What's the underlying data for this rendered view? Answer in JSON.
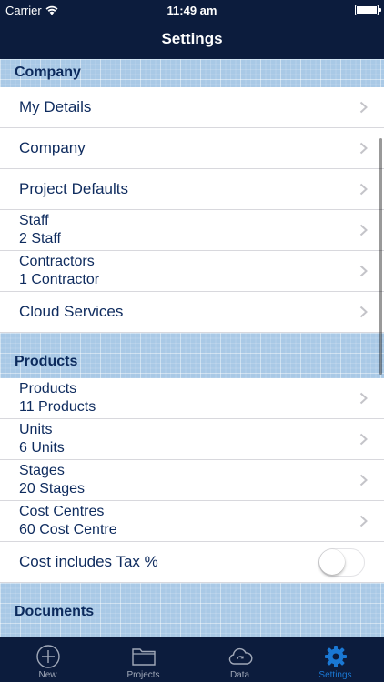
{
  "status_bar": {
    "carrier": "Carrier",
    "time": "11:49 am"
  },
  "nav": {
    "title": "Settings"
  },
  "sections": {
    "company": {
      "header": "Company"
    },
    "products": {
      "header": "Products"
    },
    "documents": {
      "header": "Documents"
    }
  },
  "company_rows": {
    "my_details": {
      "title": "My Details"
    },
    "company": {
      "title": "Company"
    },
    "project_defaults": {
      "title": "Project Defaults"
    },
    "staff": {
      "title": "Staff",
      "subtitle": "2 Staff"
    },
    "contractors": {
      "title": "Contractors",
      "subtitle": "1 Contractor"
    },
    "cloud_services": {
      "title": "Cloud Services"
    }
  },
  "product_rows": {
    "products": {
      "title": "Products",
      "subtitle": "11 Products"
    },
    "units": {
      "title": "Units",
      "subtitle": "6 Units"
    },
    "stages": {
      "title": "Stages",
      "subtitle": "20 Stages"
    },
    "cost_centres": {
      "title": "Cost Centres",
      "subtitle": "60 Cost Centre"
    },
    "cost_tax": {
      "title": "Cost includes Tax %",
      "toggle_on": false
    }
  },
  "tabs": [
    {
      "label": "New",
      "icon": "plus-circle-icon",
      "active": false
    },
    {
      "label": "Projects",
      "icon": "folder-icon",
      "active": false
    },
    {
      "label": "Data",
      "icon": "cloud-sync-icon",
      "active": false
    },
    {
      "label": "Settings",
      "icon": "gear-icon",
      "active": true
    }
  ],
  "colors": {
    "nav_bg": "#0c1c3d",
    "accent": "#1a78d4",
    "text": "#0e2b5e",
    "section_bg": "#a9c9e6"
  }
}
